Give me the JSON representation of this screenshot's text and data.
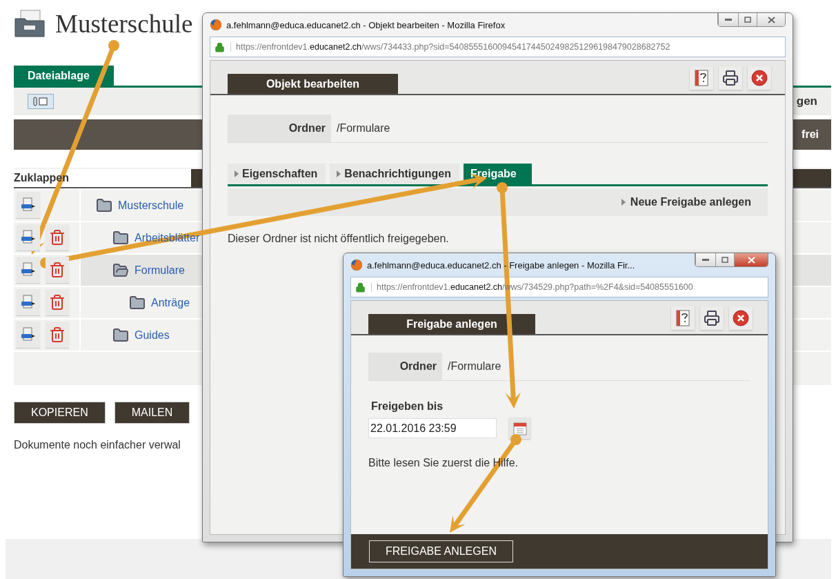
{
  "page": {
    "title": "Musterschule",
    "tab": "Dateiablage",
    "toolbar_text": "gen",
    "storage_text": "frei",
    "tree_header": "Zuklappen",
    "tree": [
      {
        "name": "Musterschule",
        "selected": false,
        "deletable": false,
        "children": [
          {
            "name": "Arbeitsblätter",
            "selected": false,
            "deletable": true
          },
          {
            "name": "Formulare",
            "selected": true,
            "deletable": true,
            "children": [
              {
                "name": "Anträge",
                "selected": false,
                "deletable": true
              }
            ]
          },
          {
            "name": "Guides",
            "selected": false,
            "deletable": true
          }
        ]
      }
    ],
    "buttons": [
      "KOPIEREN",
      "MAILEN"
    ],
    "footer_text": "Dokumente noch einfacher verwal"
  },
  "edit_window": {
    "title": "a.fehlmann@educa.educanet2.ch - Objekt bearbeiten - Mozilla Firefox",
    "active": false,
    "url": "https://enfrontdev1.**educanet2.ch**/wws/734433.php?sid=5408555160094541744502498251296198479028682752",
    "heading": "Objekt bearbeiten",
    "field": {
      "label": "Ordner",
      "value": "/Formulare"
    },
    "tabs": [
      {
        "label": "Eigenschaften",
        "selected": false
      },
      {
        "label": "Benachrichtigungen",
        "selected": false
      },
      {
        "label": "Freigabe",
        "selected": true
      }
    ],
    "action": "Neue Freigabe anlegen",
    "message": "Dieser Ordner ist nicht öffentlich freigegeben."
  },
  "share_window": {
    "title": "a.fehlmann@educa.educanet2.ch - Freigabe anlegen - Mozilla Fir...",
    "active": true,
    "url": "https://enfrontdev1.**educanet2.ch**/wws/734529.php?path=%2F4&sid=54085551600",
    "heading": "Freigabe anlegen",
    "field": {
      "label": "Ordner",
      "value": "/Formulare"
    },
    "date_label": "Freigeben bis",
    "date_value": "22.01.2016 23:59",
    "hint": "Bitte lesen Sie zuerst die Hilfe.",
    "submit": "FREIGABE ANLEGEN"
  }
}
